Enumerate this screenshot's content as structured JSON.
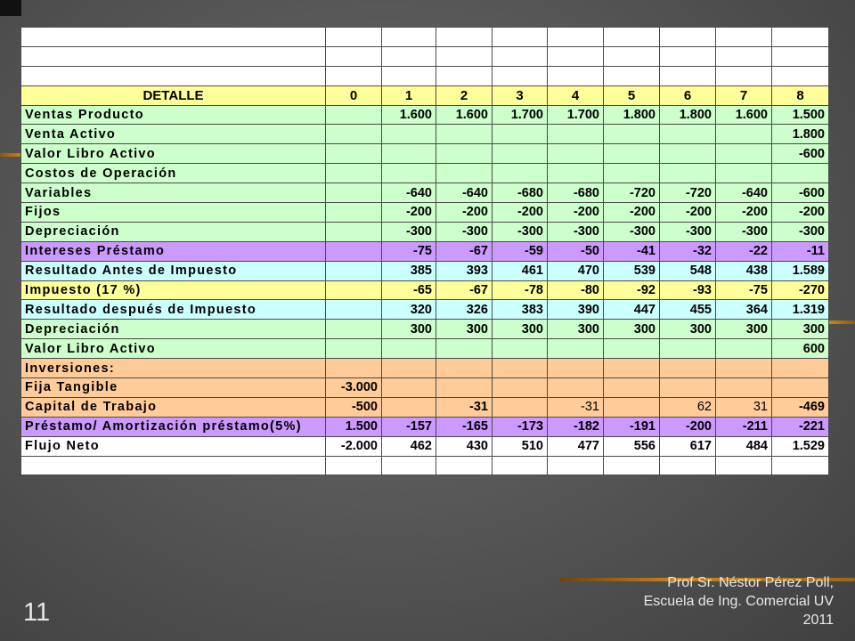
{
  "slide": {
    "number": "11"
  },
  "footer": {
    "line1": "Prof Sr. Néstor Pérez Poll,",
    "line2": "Escuela de Ing. Comercial UV",
    "line3": "2011"
  },
  "colors": {
    "header": "#ffff99",
    "green": "#ccffcc",
    "purple": "#cc99ff",
    "cyan": "#ccffff",
    "yellow": "#ffff99",
    "orange": "#ffcc99",
    "stripe": "#c9861a"
  },
  "table": {
    "headers": [
      "DETALLE",
      "0",
      "1",
      "2",
      "3",
      "4",
      "5",
      "6",
      "7",
      "8"
    ],
    "rows": [
      {
        "color": "green",
        "label": "Ventas Producto",
        "values": [
          "",
          "1.600",
          "1.600",
          "1.700",
          "1.700",
          "1.800",
          "1.800",
          "1.600",
          "1.500"
        ]
      },
      {
        "color": "green",
        "label": "Venta Activo",
        "values": [
          "",
          "",
          "",
          "",
          "",
          "",
          "",
          "",
          "1.800"
        ]
      },
      {
        "color": "green",
        "label": "Valor Libro Activo",
        "values": [
          "",
          "",
          "",
          "",
          "",
          "",
          "",
          "",
          "-600"
        ]
      },
      {
        "color": "green",
        "label": "Costos de Operación",
        "values": [
          "",
          "",
          "",
          "",
          "",
          "",
          "",
          "",
          ""
        ]
      },
      {
        "color": "green",
        "label": "Variables",
        "values": [
          "",
          "-640",
          "-640",
          "-680",
          "-680",
          "-720",
          "-720",
          "-640",
          "-600"
        ]
      },
      {
        "color": "green",
        "label": "Fijos",
        "values": [
          "",
          "-200",
          "-200",
          "-200",
          "-200",
          "-200",
          "-200",
          "-200",
          "-200"
        ]
      },
      {
        "color": "green",
        "label": "Depreciación",
        "values": [
          "",
          "-300",
          "-300",
          "-300",
          "-300",
          "-300",
          "-300",
          "-300",
          "-300"
        ]
      },
      {
        "color": "purple",
        "label": "Intereses Préstamo",
        "values": [
          "",
          "-75",
          "-67",
          "-59",
          "-50",
          "-41",
          "-32",
          "-22",
          "-11"
        ]
      },
      {
        "color": "cyan",
        "label": "Resultado Antes de Impuesto",
        "values": [
          "",
          "385",
          "393",
          "461",
          "470",
          "539",
          "548",
          "438",
          "1.589"
        ]
      },
      {
        "color": "yellow",
        "label": "Impuesto (17 %)",
        "values": [
          "",
          "-65",
          "-67",
          "-78",
          "-80",
          "-92",
          "-93",
          "-75",
          "-270"
        ]
      },
      {
        "color": "cyan",
        "label": "Resultado después de Impuesto",
        "values": [
          "",
          "320",
          "326",
          "383",
          "390",
          "447",
          "455",
          "364",
          "1.319"
        ]
      },
      {
        "color": "green",
        "label": "Depreciación",
        "values": [
          "",
          "300",
          "300",
          "300",
          "300",
          "300",
          "300",
          "300",
          "300"
        ]
      },
      {
        "color": "green",
        "label": "Valor Libro Activo",
        "values": [
          "",
          "",
          "",
          "",
          "",
          "",
          "",
          "",
          "600"
        ]
      },
      {
        "color": "orange",
        "label": "Inversiones:",
        "values": [
          "",
          "",
          "",
          "",
          "",
          "",
          "",
          "",
          ""
        ]
      },
      {
        "color": "orange",
        "label": "Fija Tangible",
        "values": [
          "-3.000",
          "",
          "",
          "",
          "",
          "",
          "",
          "",
          ""
        ]
      },
      {
        "color": "orange",
        "label": "Capital de Trabajo",
        "values": [
          "-500",
          "",
          "-31",
          "",
          "-31",
          "",
          "62",
          "31",
          "-469"
        ],
        "plain_cols": [
          4,
          6,
          7
        ]
      },
      {
        "color": "purple",
        "label": "Préstamo/ Amortización préstamo(5%)",
        "values": [
          "1.500",
          "-157",
          "-165",
          "-173",
          "-182",
          "-191",
          "-200",
          "-211",
          "-221"
        ]
      },
      {
        "color": "white",
        "label": "Flujo Neto",
        "values": [
          "-2.000",
          "462",
          "430",
          "510",
          "477",
          "556",
          "617",
          "484",
          "1.529"
        ]
      }
    ]
  }
}
